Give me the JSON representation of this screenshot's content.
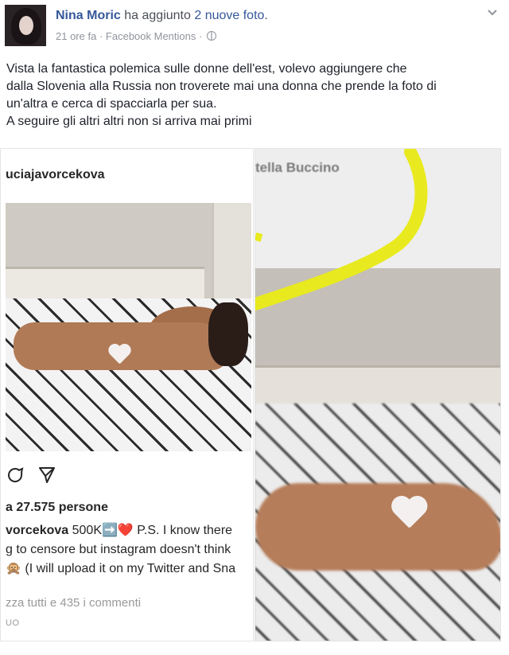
{
  "post": {
    "author": "Nina Moric",
    "action": "ha aggiunto",
    "photos_link": "2 nuove foto",
    "period": ".",
    "time": "21 ore fa",
    "separator": "·",
    "source": "Facebook Mentions",
    "separator2": "·",
    "text_lines": [
      "Vista la fantastica polemica sulle donne dell'est, volevo aggiungere che",
      "dalla Slovenia alla Russia non troverete mai una donna che prende la foto di",
      "un'altra e cerca di spacciarla per sua.",
      "A seguire gli altri altri non si arriva mai primi"
    ]
  },
  "left_photo": {
    "username": "uciajavorcekova",
    "likes": "a 27.575 persone",
    "caption_user": "vorcekova",
    "caption_lines": [
      " 500K➡️❤️ P.S. I know there",
      "g to censore but instagram doesn't think",
      "🙊 (I will upload it on my Twitter and Sna"
    ],
    "view_all": "zza tutti e 435 i commenti",
    "time_label": "UO"
  },
  "right_photo": {
    "username": "tella Buccino"
  },
  "colors": {
    "link": "#365899",
    "meta": "#90949c",
    "highlight": "#e8ea1f"
  },
  "icons": [
    "chevron-down-icon",
    "globe-icon",
    "comment-icon",
    "share-icon",
    "heart-censor-icon"
  ]
}
